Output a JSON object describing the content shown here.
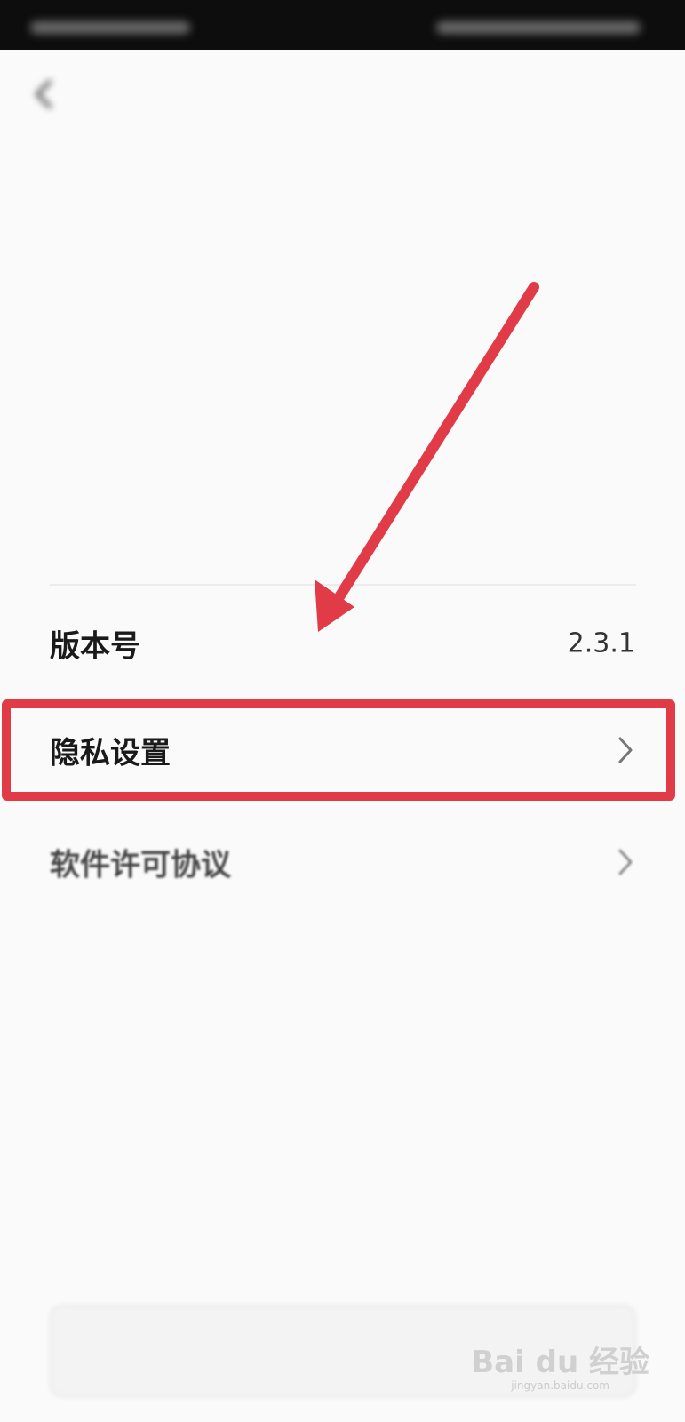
{
  "accent_color": "#e23b48",
  "statusbar": {
    "left_text": "",
    "right_text": ""
  },
  "header": {
    "title": "",
    "back_icon": "chevron-left-icon"
  },
  "blurred_items": [
    {
      "label": "",
      "value": ""
    },
    {
      "label": "",
      "value": ""
    },
    {
      "label": "",
      "value": ""
    },
    {
      "label": "",
      "value": ""
    }
  ],
  "version": {
    "label": "版本号",
    "value": "2.3.1"
  },
  "privacy": {
    "label": "隐私设置",
    "chevron_icon": "chevron-right-icon"
  },
  "license": {
    "label": "软件许可协议",
    "chevron_icon": "chevron-right-icon"
  },
  "logout_button": {
    "label": ""
  },
  "watermark": {
    "main": "Bai du 经验",
    "sub": "jingyan.baidu.com"
  }
}
